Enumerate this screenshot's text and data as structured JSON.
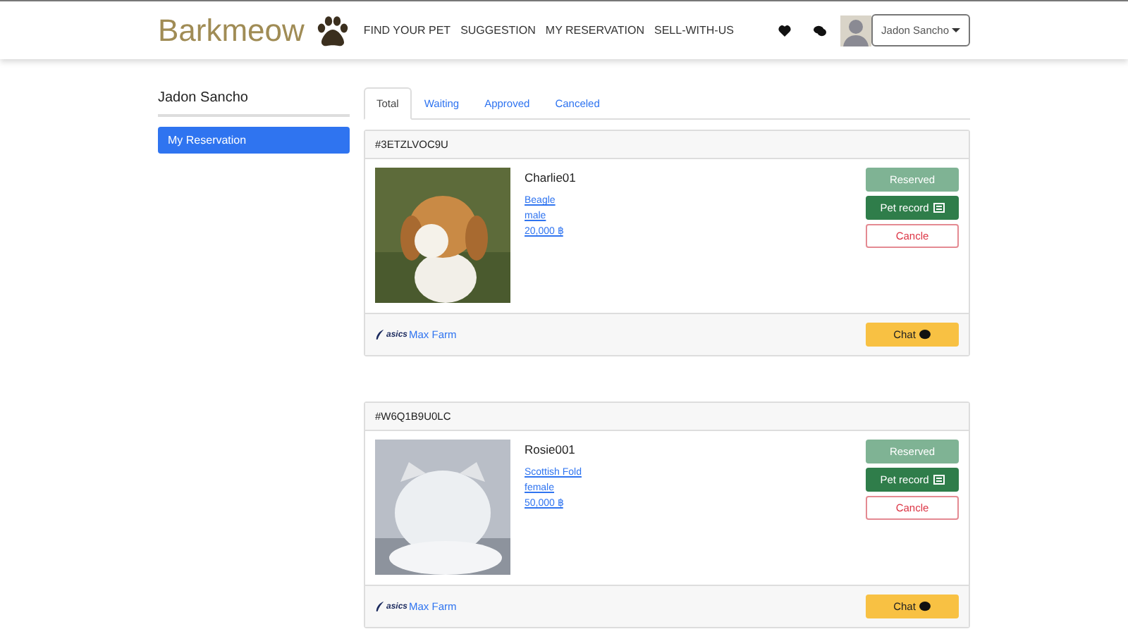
{
  "navbar": {
    "brand": "Barkmeow",
    "links": [
      "FIND YOUR PET",
      "SUGGESTION",
      "MY RESERVATION",
      "SELL-WITH-US"
    ],
    "user": "Jadon Sancho"
  },
  "sidebar": {
    "title": "Jadon Sancho",
    "items": [
      {
        "label": "My Reservation",
        "selected": true
      }
    ]
  },
  "tabs": [
    {
      "label": "Total",
      "selected": true
    },
    {
      "label": "Waiting",
      "selected": false
    },
    {
      "label": "Approved",
      "selected": false
    },
    {
      "label": "Canceled",
      "selected": false
    }
  ],
  "reservations": [
    {
      "code": "#3ETZLVOC9U",
      "pet": "Charlie01",
      "kind": "dog",
      "breed": "Beagle",
      "sex": "male",
      "price": "20,000 ฿",
      "status": "Reserved",
      "record": "Pet record",
      "cancel": "Cancle",
      "farm_logo": "asics",
      "farm": "Max Farm",
      "chat": "Chat"
    },
    {
      "code": "#W6Q1B9U0LC",
      "pet": "Rosie001",
      "kind": "cat",
      "breed": "Scottish Fold",
      "sex": "female",
      "price": "50,000 ฿",
      "status": "Reserved",
      "record": "Pet record",
      "cancel": "Cancle",
      "farm_logo": "asics",
      "farm": "Max Farm",
      "chat": "Chat"
    }
  ]
}
